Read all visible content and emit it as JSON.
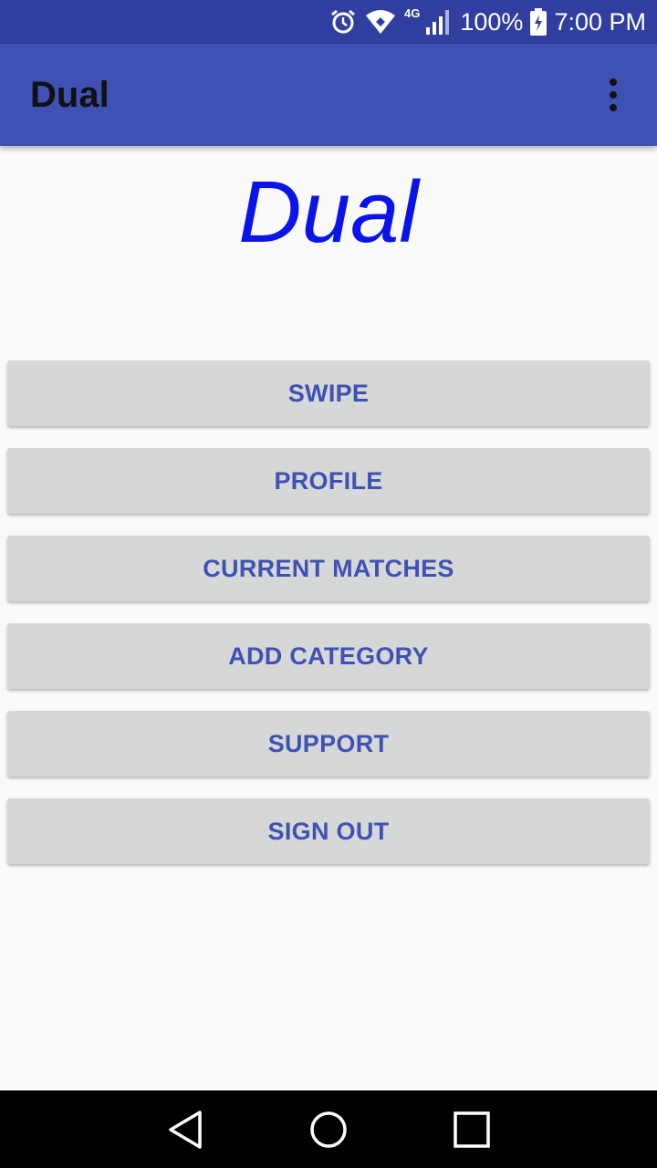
{
  "status_bar": {
    "network_label": "4G",
    "battery_percent": "100%",
    "time": "7:00 PM",
    "icons": [
      "alarm-icon",
      "wifi-icon",
      "signal-icon",
      "battery-charging-icon"
    ]
  },
  "app_bar": {
    "title": "Dual",
    "overflow_icon": "more-vert-icon"
  },
  "main": {
    "hero_title": "Dual",
    "buttons": [
      {
        "label": "SWIPE"
      },
      {
        "label": "PROFILE"
      },
      {
        "label": "CURRENT MATCHES"
      },
      {
        "label": "ADD CATEGORY"
      },
      {
        "label": "SUPPORT"
      },
      {
        "label": "SIGN OUT"
      }
    ]
  },
  "nav_bar": {
    "icons": [
      "back-icon",
      "home-icon",
      "recents-icon"
    ]
  },
  "colors": {
    "status_bar": "#303f9f",
    "app_bar": "#3f51b5",
    "button_bg": "#d6d7d7",
    "button_text": "#3f51b5",
    "hero_title": "#0a14e8",
    "background": "#fafafa"
  }
}
